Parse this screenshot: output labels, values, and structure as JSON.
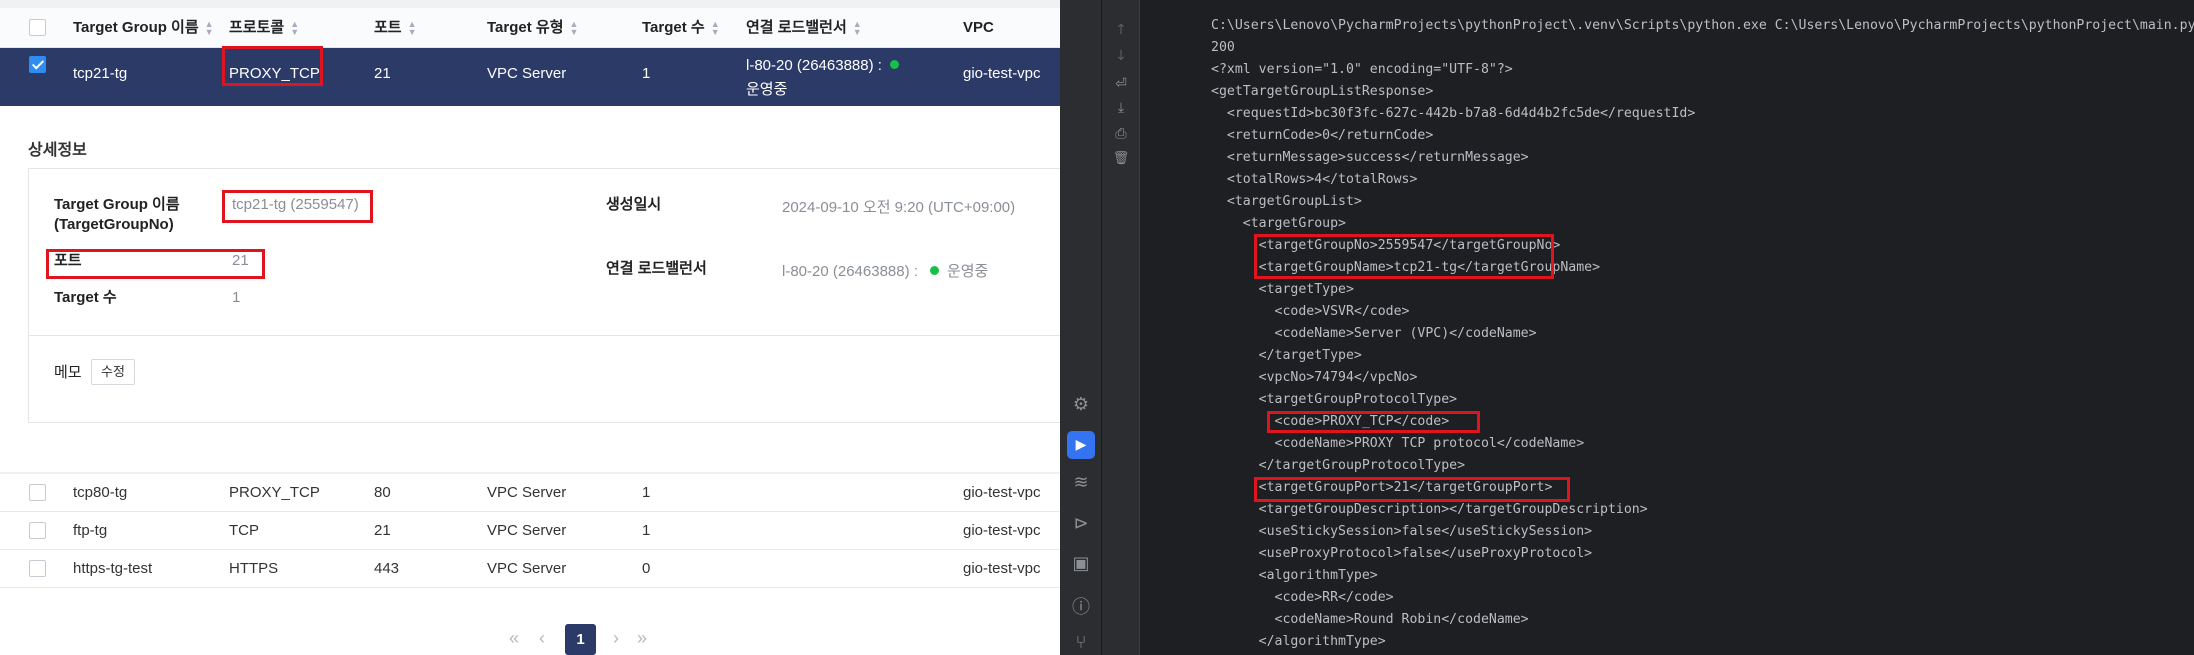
{
  "table": {
    "columns": [
      "Target Group 이름",
      "프로토콜",
      "포트",
      "Target 유형",
      "Target 수",
      "연결 로드밸런서",
      "VPC"
    ],
    "selected_row": {
      "name": "tcp21-tg",
      "protocol": "PROXY_TCP",
      "port": "21",
      "target_type": "VPC Server",
      "target_count": "1",
      "lb_line1": "l-80-20 (26463888) :",
      "lb_line2": "운영중",
      "vpc": "gio-test-vpc"
    },
    "rows": [
      {
        "name": "tcp80-tg",
        "protocol": "PROXY_TCP",
        "port": "80",
        "target_type": "VPC Server",
        "target_count": "1",
        "vpc": "gio-test-vpc"
      },
      {
        "name": "ftp-tg",
        "protocol": "TCP",
        "port": "21",
        "target_type": "VPC Server",
        "target_count": "1",
        "vpc": "gio-test-vpc"
      },
      {
        "name": "https-tg-test",
        "protocol": "HTTPS",
        "port": "443",
        "target_type": "VPC Server",
        "target_count": "0",
        "vpc": "gio-test-vpc"
      }
    ]
  },
  "detail": {
    "title": "상세정보",
    "name_label_1": "Target Group 이름",
    "name_label_2": "(TargetGroupNo)",
    "name_value": "tcp21-tg (2559547)",
    "port_label": "포트",
    "port_value": "21",
    "count_label": "Target 수",
    "count_value": "1",
    "created_label": "생성일시",
    "created_value": "2024-09-10 오전 9:20 (UTC+09:00)",
    "lb_label": "연결 로드밸런서",
    "lb_value": "l-80-20 (26463888) :",
    "lb_status": "운영중",
    "memo_label": "메모",
    "memo_button": "수정"
  },
  "pager": {
    "first": "«",
    "prev": "‹",
    "current": "1",
    "next": "›",
    "last": "»"
  },
  "console": {
    "lines": [
      "C:\\Users\\Lenovo\\PycharmProjects\\pythonProject\\.venv\\Scripts\\python.exe C:\\Users\\Lenovo\\PycharmProjects\\pythonProject\\main.py",
      "200",
      "<?xml version=\"1.0\" encoding=\"UTF-8\"?>",
      "<getTargetGroupListResponse>",
      "  <requestId>bc30f3fc-627c-442b-b7a8-6d4d4b2fc5de</requestId>",
      "  <returnCode>0</returnCode>",
      "  <returnMessage>success</returnMessage>",
      "  <totalRows>4</totalRows>",
      "  <targetGroupList>",
      "    <targetGroup>",
      "      <targetGroupNo>2559547</targetGroupNo>",
      "      <targetGroupName>tcp21-tg</targetGroupName>",
      "      <targetType>",
      "        <code>VSVR</code>",
      "        <codeName>Server (VPC)</codeName>",
      "      </targetType>",
      "      <vpcNo>74794</vpcNo>",
      "      <targetGroupProtocolType>",
      "        <code>PROXY_TCP</code>",
      "        <codeName>PROXY TCP protocol</codeName>",
      "      </targetGroupProtocolType>",
      "      <targetGroupPort>21</targetGroupPort>",
      "      <targetGroupDescription></targetGroupDescription>",
      "      <useStickySession>false</useStickySession>",
      "      <useProxyProtocol>false</useProxyProtocol>",
      "      <algorithmType>",
      "        <code>RR</code>",
      "        <codeName>Round Robin</codeName>",
      "      </algorithmType>"
    ]
  },
  "icons": {
    "up": "↑",
    "down": "↓",
    "wrap": "⏎",
    "scroll_end": "⤓",
    "print": "⎙",
    "trash": "🗑",
    "python": "⚙",
    "run": "▶",
    "layers": "≋",
    "services": "⊳",
    "terminal": "▣",
    "problems": "ⓘ",
    "git": "⑂"
  },
  "colors": {
    "selected_row_bg": "#2b3a67",
    "highlight_red": "#e0141e",
    "status_green": "#18c04a",
    "ide_bg": "#1e1f22",
    "ide_text": "#bcbec4",
    "run_blue": "#3574f0"
  }
}
